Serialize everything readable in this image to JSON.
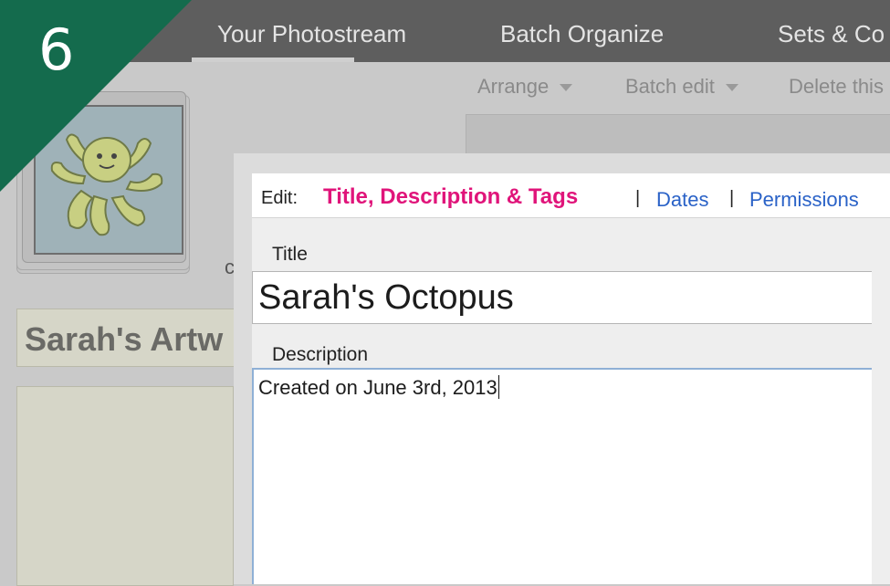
{
  "step_badge": {
    "number": "6",
    "color": "#146b4d"
  },
  "topnav": {
    "tabs": [
      {
        "label": "Your Photostream"
      },
      {
        "label": "Batch Organize"
      },
      {
        "label": "Sets & Co"
      }
    ]
  },
  "subnav": {
    "arrange": "Arrange",
    "batch_edit": "Batch edit",
    "delete": "Delete this"
  },
  "background": {
    "partial_char": "c",
    "album_title": "Sarah's Artw"
  },
  "edit_dialog": {
    "edit_label": "Edit:",
    "tabs": {
      "active": "Title, Description & Tags",
      "dates": "Dates",
      "permissions": "Permissions"
    },
    "separator": "|",
    "title_label": "Title",
    "title_value": "Sarah's Octopus",
    "description_label": "Description",
    "description_value": "Created on June 3rd, 2013",
    "active_tab_color": "#e0147a",
    "link_color": "#2a62c7"
  }
}
